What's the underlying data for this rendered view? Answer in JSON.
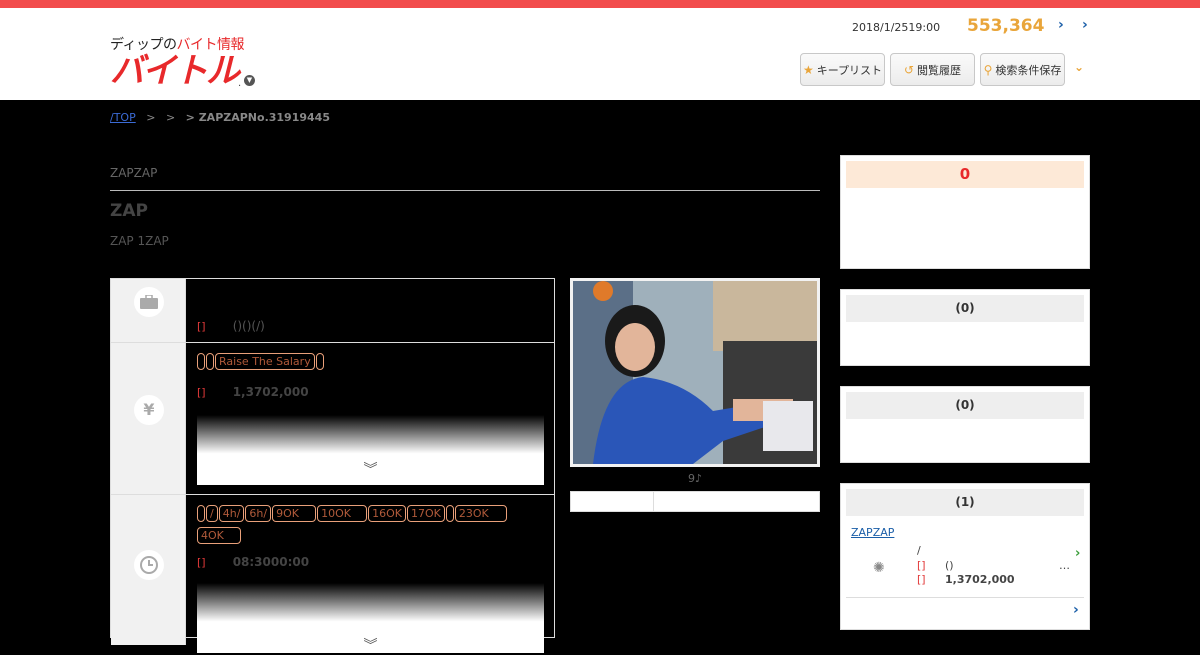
{
  "header": {
    "logo_sub_1": "ディップの",
    "logo_sub_2": "バイト情報",
    "logo_main": "バイトル",
    "logo_dot": ".",
    "date": "2018/1/2519:00",
    "count": "553,364",
    "arrow_1": "›",
    "arrow_2": "›",
    "buttons": [
      {
        "icon": "★",
        "label": "キープリスト"
      },
      {
        "icon": "↺",
        "label": "閲覧履歴"
      },
      {
        "icon": "⚲",
        "label": "検索条件保存"
      }
    ],
    "more": "⌄"
  },
  "breadcrumb": {
    "top": "/TOP",
    "sep1": ">",
    "sep2": ">",
    "last": "> ZAPZAPNo.31919445"
  },
  "job": {
    "company": "ZAPZAP",
    "title": "ZAP",
    "subtitle": "ZAP 1ZAP"
  },
  "rows": [
    {
      "icon": "briefcase-icon",
      "label": "[]",
      "value": "()()(/)"
    },
    {
      "icon": "yen-icon",
      "tags": [
        "",
        "",
        "Raise The Salary",
        ""
      ],
      "label": "[]",
      "value": "1,3702,000",
      "chev": "︾"
    },
    {
      "icon": "clock-icon",
      "tags": [
        "",
        "/",
        "4h/",
        "6h/",
        "9OK",
        "10OK",
        "16OK",
        "17OK",
        "",
        "23OK",
        "4OK"
      ],
      "label": "[]",
      "value": "08:3000:00",
      "chev": "︾"
    }
  ],
  "photo": {
    "caption": "9♪"
  },
  "sidebar": {
    "box1": {
      "head": "0"
    },
    "box2": {
      "head": "(0)"
    },
    "box3": {
      "head": "(0)"
    },
    "box4": {
      "head": "(1)",
      "link": "ZAPZAP",
      "slash": "/",
      "paren": "()",
      "red1": "[]",
      "red2": "[]",
      "value": "1,3702,000",
      "ellipsis": "…",
      "arrow": "›",
      "arrow2": "›"
    }
  },
  "colors": {
    "accent": "#f24c4c",
    "brand": "#e8292b",
    "count": "#e9a53a",
    "link": "#1a5ea8"
  }
}
